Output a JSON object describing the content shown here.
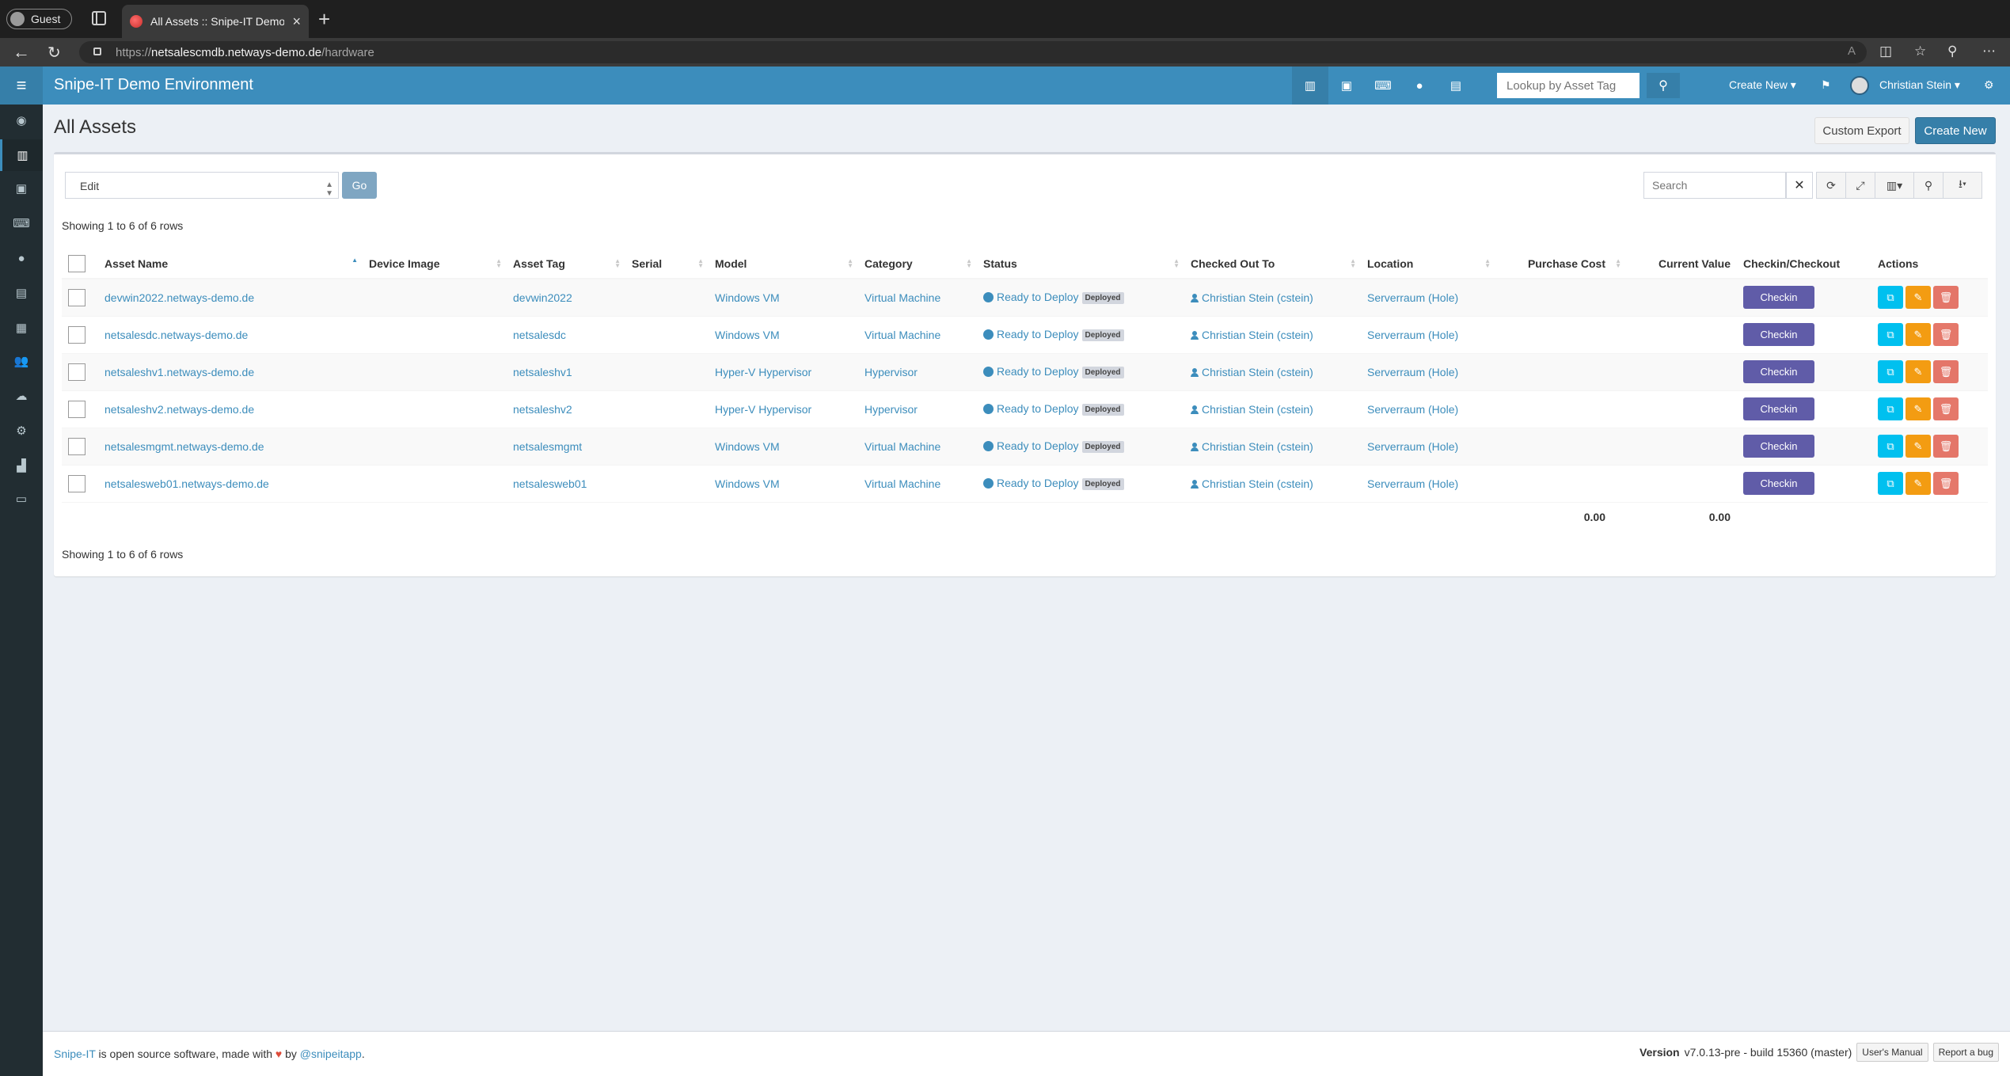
{
  "browser": {
    "profile_label": "Guest",
    "tab_title": "All Assets :: Snipe-IT Demo Environment",
    "new_tab": "+",
    "tab_close": "×",
    "url_prefix": "https://",
    "url_host": "netsalescmdb.netways-demo.de",
    "url_path": "/hardware"
  },
  "header": {
    "brand": "Snipe-IT Demo Environment",
    "lookup_placeholder": "Lookup by Asset Tag",
    "create_new": "Create New",
    "user_name": "Christian Stein"
  },
  "sidebar": {
    "items": [
      "dashboard-icon",
      "assets-icon",
      "licenses-icon",
      "accessories-icon",
      "consumables-icon",
      "components-icon",
      "kits-icon",
      "people-icon",
      "import-icon",
      "settings-icon",
      "reports-icon",
      "requestable-icon"
    ]
  },
  "page": {
    "title": "All Assets",
    "custom_export": "Custom Export",
    "create_new": "Create New"
  },
  "toolbar": {
    "bulk_action": "Edit",
    "go": "Go",
    "search_placeholder": "Search"
  },
  "table": {
    "showing_top": "Showing 1 to 6 of 6 rows",
    "showing_bottom": "Showing 1 to 6 of 6 rows",
    "columns": {
      "asset_name": "Asset Name",
      "device_image": "Device Image",
      "asset_tag": "Asset Tag",
      "serial": "Serial",
      "model": "Model",
      "category": "Category",
      "status": "Status",
      "checked_out_to": "Checked Out To",
      "location": "Location",
      "purchase_cost": "Purchase Cost",
      "current_value": "Current Value",
      "checkin_checkout": "Checkin/Checkout",
      "actions": "Actions"
    },
    "rows": [
      {
        "name": "devwin2022.netways-demo.de",
        "tag": "devwin2022",
        "model": "Windows VM",
        "category": "Virtual Machine",
        "status": "Ready to Deploy",
        "status_label": "Deployed",
        "checked_out_to": "Christian Stein (cstein)",
        "location": "Serverraum (Hole)",
        "checkin": "Checkin"
      },
      {
        "name": "netsalesdc.netways-demo.de",
        "tag": "netsalesdc",
        "model": "Windows VM",
        "category": "Virtual Machine",
        "status": "Ready to Deploy",
        "status_label": "Deployed",
        "checked_out_to": "Christian Stein (cstein)",
        "location": "Serverraum (Hole)",
        "checkin": "Checkin"
      },
      {
        "name": "netsaleshv1.netways-demo.de",
        "tag": "netsaleshv1",
        "model": "Hyper-V Hypervisor",
        "category": "Hypervisor",
        "status": "Ready to Deploy",
        "status_label": "Deployed",
        "checked_out_to": "Christian Stein (cstein)",
        "location": "Serverraum (Hole)",
        "checkin": "Checkin"
      },
      {
        "name": "netsaleshv2.netways-demo.de",
        "tag": "netsaleshv2",
        "model": "Hyper-V Hypervisor",
        "category": "Hypervisor",
        "status": "Ready to Deploy",
        "status_label": "Deployed",
        "checked_out_to": "Christian Stein (cstein)",
        "location": "Serverraum (Hole)",
        "checkin": "Checkin"
      },
      {
        "name": "netsalesmgmt.netways-demo.de",
        "tag": "netsalesmgmt",
        "model": "Windows VM",
        "category": "Virtual Machine",
        "status": "Ready to Deploy",
        "status_label": "Deployed",
        "checked_out_to": "Christian Stein (cstein)",
        "location": "Serverraum (Hole)",
        "checkin": "Checkin"
      },
      {
        "name": "netsalesweb01.netways-demo.de",
        "tag": "netsalesweb01",
        "model": "Windows VM",
        "category": "Virtual Machine",
        "status": "Ready to Deploy",
        "status_label": "Deployed",
        "checked_out_to": "Christian Stein (cstein)",
        "location": "Serverraum (Hole)",
        "checkin": "Checkin"
      }
    ],
    "totals": {
      "purchase_cost": "0.00",
      "current_value": "0.00"
    }
  },
  "footer": {
    "brand_link": "Snipe-IT",
    "text_before_heart": " is open source software, made with ",
    "text_after_heart": " by ",
    "handle": "@snipeitapp",
    "period": ".",
    "version_label": "Version",
    "version_value": "v7.0.13-pre - build 15360 (master)",
    "manual": "User's Manual",
    "bug": "Report a bug"
  },
  "colors": {
    "header": "#3c8dbc",
    "sidebar": "#222d32",
    "checkin": "#605ca8",
    "clone": "#00c0ef",
    "edit": "#f39c12",
    "delete": "#dd4b39"
  }
}
